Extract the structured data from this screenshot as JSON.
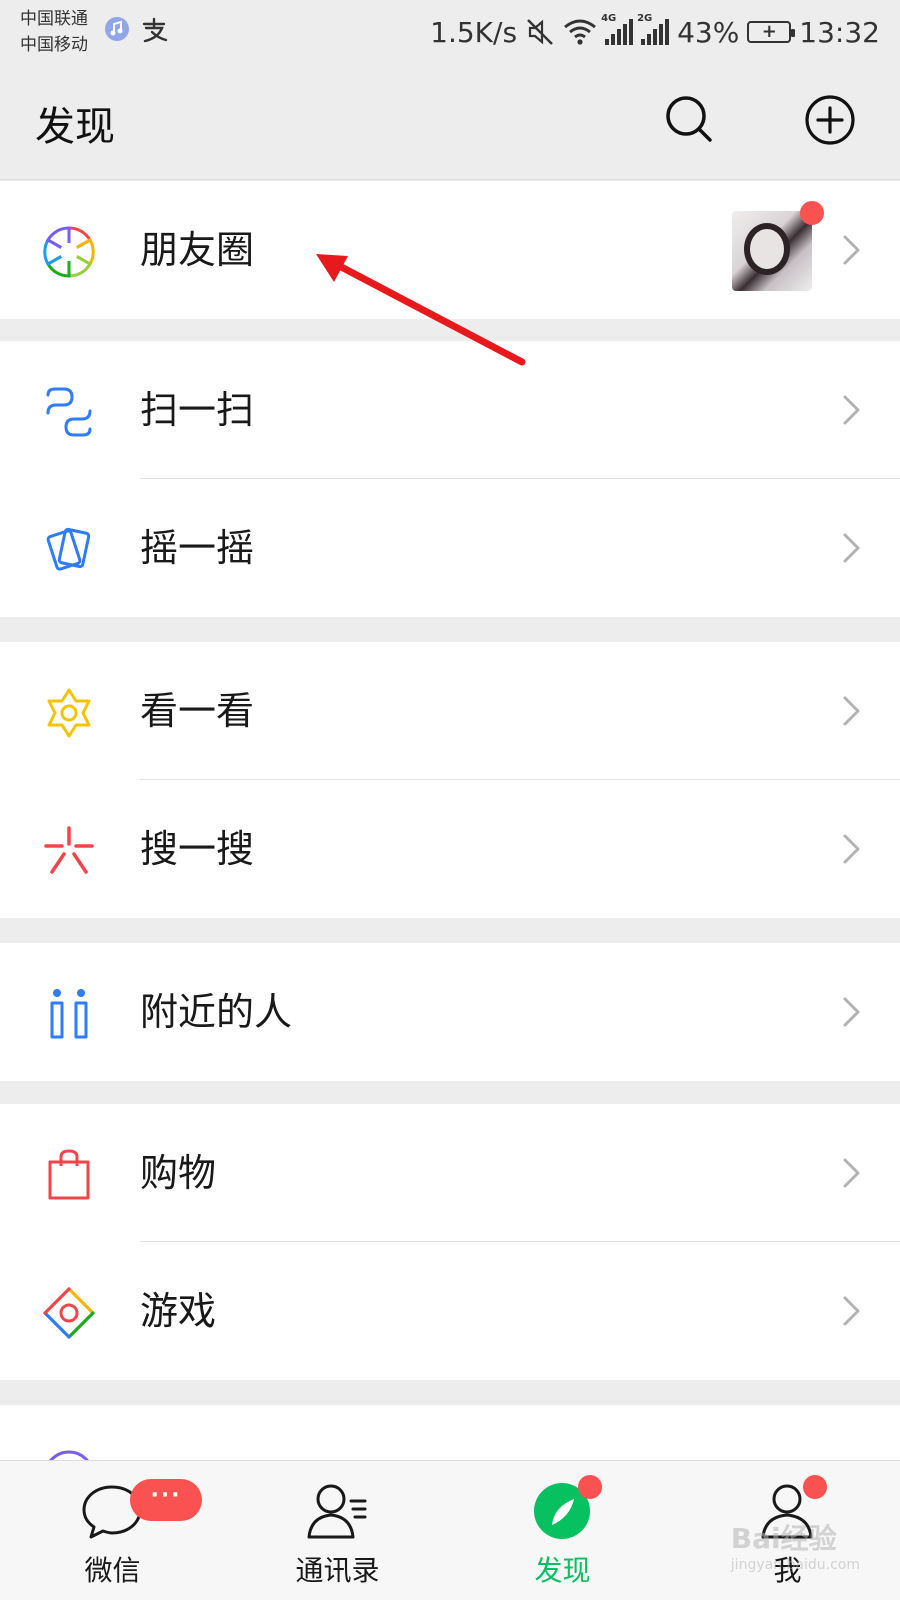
{
  "status_bar": {
    "carrier_1": "中国联通",
    "carrier_2": "中国移动",
    "speed": "1.5K/s",
    "net_1": "4G",
    "net_2": "2G",
    "battery": "43%",
    "time": "13:32"
  },
  "header": {
    "title": "发现",
    "search_icon": "search-icon",
    "add_icon": "plus-circle-icon"
  },
  "items": [
    {
      "label": "朋友圈",
      "icon": "moments-aperture-icon"
    },
    {
      "label": "扫一扫",
      "icon": "scan-icon"
    },
    {
      "label": "摇一摇",
      "icon": "shake-icon"
    },
    {
      "label": "看一看",
      "icon": "top-stories-icon"
    },
    {
      "label": "搜一搜",
      "icon": "search-burst-icon"
    },
    {
      "label": "附近的人",
      "icon": "people-nearby-icon"
    },
    {
      "label": "购物",
      "icon": "shopping-bag-icon"
    },
    {
      "label": "游戏",
      "icon": "games-icon"
    }
  ],
  "tabs": [
    {
      "label": "微信",
      "badge": "···",
      "icon": "chat-bubble-icon"
    },
    {
      "label": "通讯录",
      "icon": "contacts-icon"
    },
    {
      "label": "发现",
      "icon": "compass-icon",
      "active": true
    },
    {
      "label": "我",
      "icon": "me-icon"
    }
  ],
  "colors": {
    "accent": "#07c160",
    "badge": "#fa5151",
    "annotation_arrow": "#e8191d",
    "background": "#ededed"
  },
  "watermark": {
    "brand": "Bai经验",
    "url": "jingyan.baidu.com"
  }
}
